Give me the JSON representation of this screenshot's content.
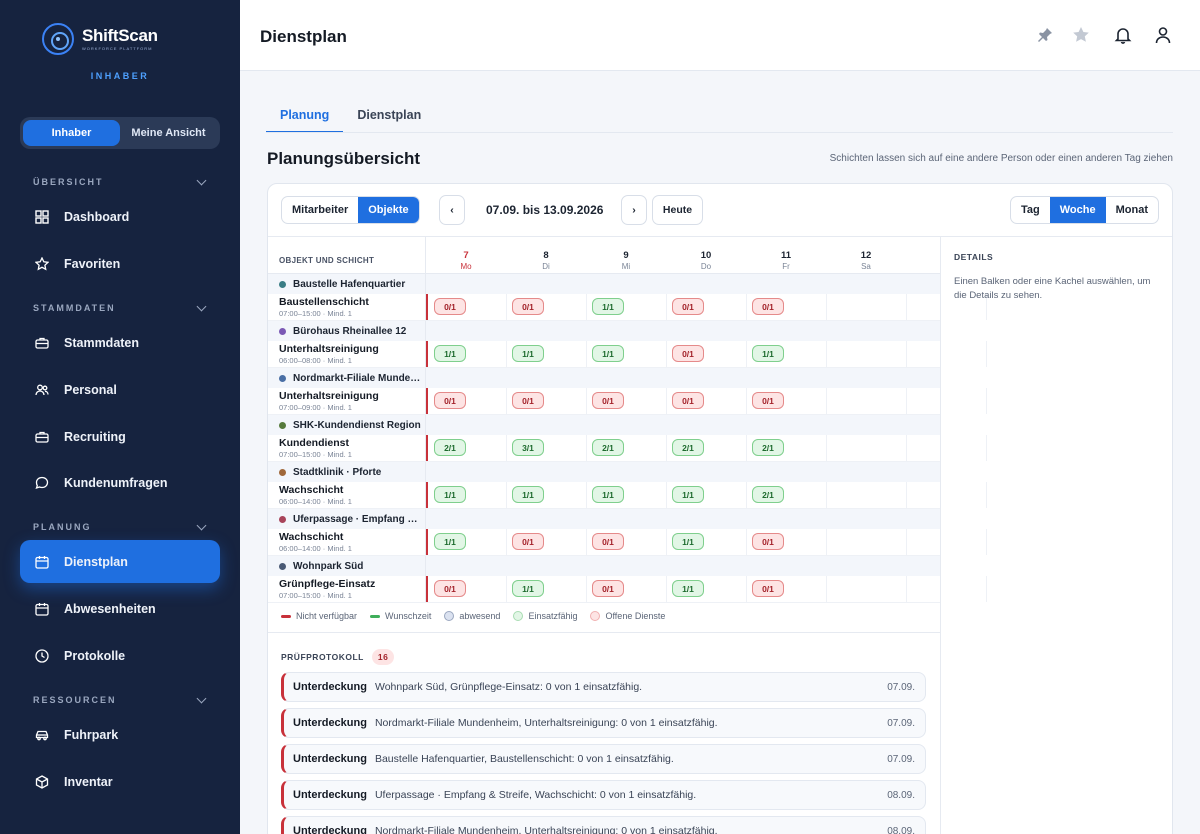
{
  "app": {
    "logo_name": "ShiftScan",
    "logo_sub": "WORKFORCE PLATTFORM",
    "role": "INHABER",
    "view_toggle": [
      "Inhaber",
      "Meine Ansicht"
    ]
  },
  "sidebar": {
    "sections": {
      "overview": "ÜBERSICHT",
      "master": "STAMMDATEN",
      "planning": "PLANUNG",
      "resources": "RESSOURCEN"
    },
    "items": [
      {
        "label": "Dashboard",
        "icon": "grid-icon"
      },
      {
        "label": "Favoriten",
        "icon": "star-icon"
      },
      {
        "label": "Stammdaten",
        "icon": "briefcase-icon"
      },
      {
        "label": "Personal",
        "icon": "users-icon"
      },
      {
        "label": "Recruiting",
        "icon": "briefcase-icon"
      },
      {
        "label": "Kundenumfragen",
        "icon": "chat-icon"
      },
      {
        "label": "Dienstplan",
        "icon": "calendar-icon"
      },
      {
        "label": "Abwesenheiten",
        "icon": "calendar-icon"
      },
      {
        "label": "Protokolle",
        "icon": "clock-icon"
      },
      {
        "label": "Fuhrpark",
        "icon": "car-icon"
      },
      {
        "label": "Inventar",
        "icon": "box-icon"
      }
    ]
  },
  "header": {
    "title": "Dienstplan",
    "icons": [
      "pin-icon",
      "star-icon",
      "bell-icon",
      "user-icon"
    ]
  },
  "tabs": [
    "Planung",
    "Dienstplan"
  ],
  "overview": {
    "title": "Planungsübersicht",
    "hint": "Schichten lassen sich auf eine andere Person oder einen anderen Tag ziehen"
  },
  "toolbar": {
    "mode": [
      "Mitarbeiter",
      "Objekte"
    ],
    "prev": "‹",
    "next": "›",
    "range": "07.09. bis 13.09.2026",
    "today": "Heute",
    "views": [
      "Tag",
      "Woche",
      "Monat"
    ]
  },
  "grid": {
    "col_label": "OBJEKT UND SCHICHT",
    "days": [
      {
        "num": "7",
        "wd": "Mo"
      },
      {
        "num": "8",
        "wd": "Di"
      },
      {
        "num": "9",
        "wd": "Mi"
      },
      {
        "num": "10",
        "wd": "Do"
      },
      {
        "num": "11",
        "wd": "Fr"
      },
      {
        "num": "12",
        "wd": "Sa"
      }
    ],
    "groups": [
      {
        "name": "Baustelle Hafenquartier",
        "color": "#3a7d85",
        "shift": "Baustellenschicht",
        "meta": "07:00–15:00 · Mind. 1",
        "cells": [
          {
            "v": "0/1",
            "s": "red"
          },
          {
            "v": "0/1",
            "s": "red"
          },
          {
            "v": "1/1",
            "s": "green"
          },
          {
            "v": "0/1",
            "s": "red"
          },
          {
            "v": "0/1",
            "s": "red"
          }
        ]
      },
      {
        "name": "Bürohaus Rheinallee 12",
        "color": "#7b59b5",
        "shift": "Unterhaltsreinigung",
        "meta": "06:00–08:00 · Mind. 1",
        "cells": [
          {
            "v": "1/1",
            "s": "green"
          },
          {
            "v": "1/1",
            "s": "green"
          },
          {
            "v": "1/1",
            "s": "green"
          },
          {
            "v": "0/1",
            "s": "red"
          },
          {
            "v": "1/1",
            "s": "green"
          }
        ]
      },
      {
        "name": "Nordmarkt-Filiale Mundenheim",
        "color": "#4a6fa5",
        "shift": "Unterhaltsreinigung",
        "meta": "07:00–09:00 · Mind. 1",
        "cells": [
          {
            "v": "0/1",
            "s": "red"
          },
          {
            "v": "0/1",
            "s": "red"
          },
          {
            "v": "0/1",
            "s": "red"
          },
          {
            "v": "0/1",
            "s": "red"
          },
          {
            "v": "0/1",
            "s": "red"
          }
        ]
      },
      {
        "name": "SHK-Kundendienst Region",
        "color": "#567a3c",
        "shift": "Kundendienst",
        "meta": "07:00–15:00 · Mind. 1",
        "cells": [
          {
            "v": "2/1",
            "s": "green"
          },
          {
            "v": "3/1",
            "s": "green"
          },
          {
            "v": "2/1",
            "s": "green"
          },
          {
            "v": "2/1",
            "s": "green"
          },
          {
            "v": "2/1",
            "s": "green"
          }
        ]
      },
      {
        "name": "Stadtklinik · Pforte",
        "color": "#a0683a",
        "shift": "Wachschicht",
        "meta": "06:00–14:00 · Mind. 1",
        "cells": [
          {
            "v": "1/1",
            "s": "green"
          },
          {
            "v": "1/1",
            "s": "green"
          },
          {
            "v": "1/1",
            "s": "green"
          },
          {
            "v": "1/1",
            "s": "green"
          },
          {
            "v": "2/1",
            "s": "green"
          }
        ]
      },
      {
        "name": "Uferpassage · Empfang & Streife",
        "color": "#a8445a",
        "shift": "Wachschicht",
        "meta": "06:00–14:00 · Mind. 1",
        "cells": [
          {
            "v": "1/1",
            "s": "green"
          },
          {
            "v": "0/1",
            "s": "red"
          },
          {
            "v": "0/1",
            "s": "red"
          },
          {
            "v": "1/1",
            "s": "green"
          },
          {
            "v": "0/1",
            "s": "red"
          }
        ]
      },
      {
        "name": "Wohnpark Süd",
        "color": "#4a5a75",
        "shift": "Grünpflege-Einsatz",
        "meta": "07:00–15:00 · Mind. 1",
        "cells": [
          {
            "v": "0/1",
            "s": "red"
          },
          {
            "v": "1/1",
            "s": "green"
          },
          {
            "v": "0/1",
            "s": "red"
          },
          {
            "v": "1/1",
            "s": "green"
          },
          {
            "v": "0/1",
            "s": "red"
          }
        ]
      }
    ],
    "legend": [
      {
        "label": "Nicht verfügbar",
        "kind": "bar",
        "color": "#c8313a"
      },
      {
        "label": "Wunschzeit",
        "kind": "bar",
        "color": "#3fae5a"
      },
      {
        "label": "abwesend",
        "kind": "circ",
        "color": "#dbe2f0",
        "border": "#9aa7bf"
      },
      {
        "label": "Einsatzfähig",
        "kind": "circ",
        "color": "#e2f6e6",
        "border": "#a8dcb2"
      },
      {
        "label": "Offene Dienste",
        "kind": "circ",
        "color": "#fde4e4",
        "border": "#f0b0b0"
      }
    ]
  },
  "details": {
    "title": "DETAILS",
    "text": "Einen Balken oder eine Kachel auswählen, um die Details zu sehen."
  },
  "protocol": {
    "title": "PRÜFPROTOKOLL",
    "count": "16",
    "items": [
      {
        "type": "Unterdeckung",
        "text": "Wohnpark Süd, Grünpflege-Einsatz: 0 von 1 einsatzfähig.",
        "date": "07.09."
      },
      {
        "type": "Unterdeckung",
        "text": "Nordmarkt-Filiale Mundenheim, Unterhaltsreinigung: 0 von 1 einsatzfähig.",
        "date": "07.09."
      },
      {
        "type": "Unterdeckung",
        "text": "Baustelle Hafenquartier, Baustellenschicht: 0 von 1 einsatzfähig.",
        "date": "07.09."
      },
      {
        "type": "Unterdeckung",
        "text": "Uferpassage · Empfang & Streife, Wachschicht: 0 von 1 einsatzfähig.",
        "date": "08.09."
      },
      {
        "type": "Unterdeckung",
        "text": "Nordmarkt-Filiale Mundenheim, Unterhaltsreinigung: 0 von 1 einsatzfähig.",
        "date": "08.09."
      }
    ]
  }
}
